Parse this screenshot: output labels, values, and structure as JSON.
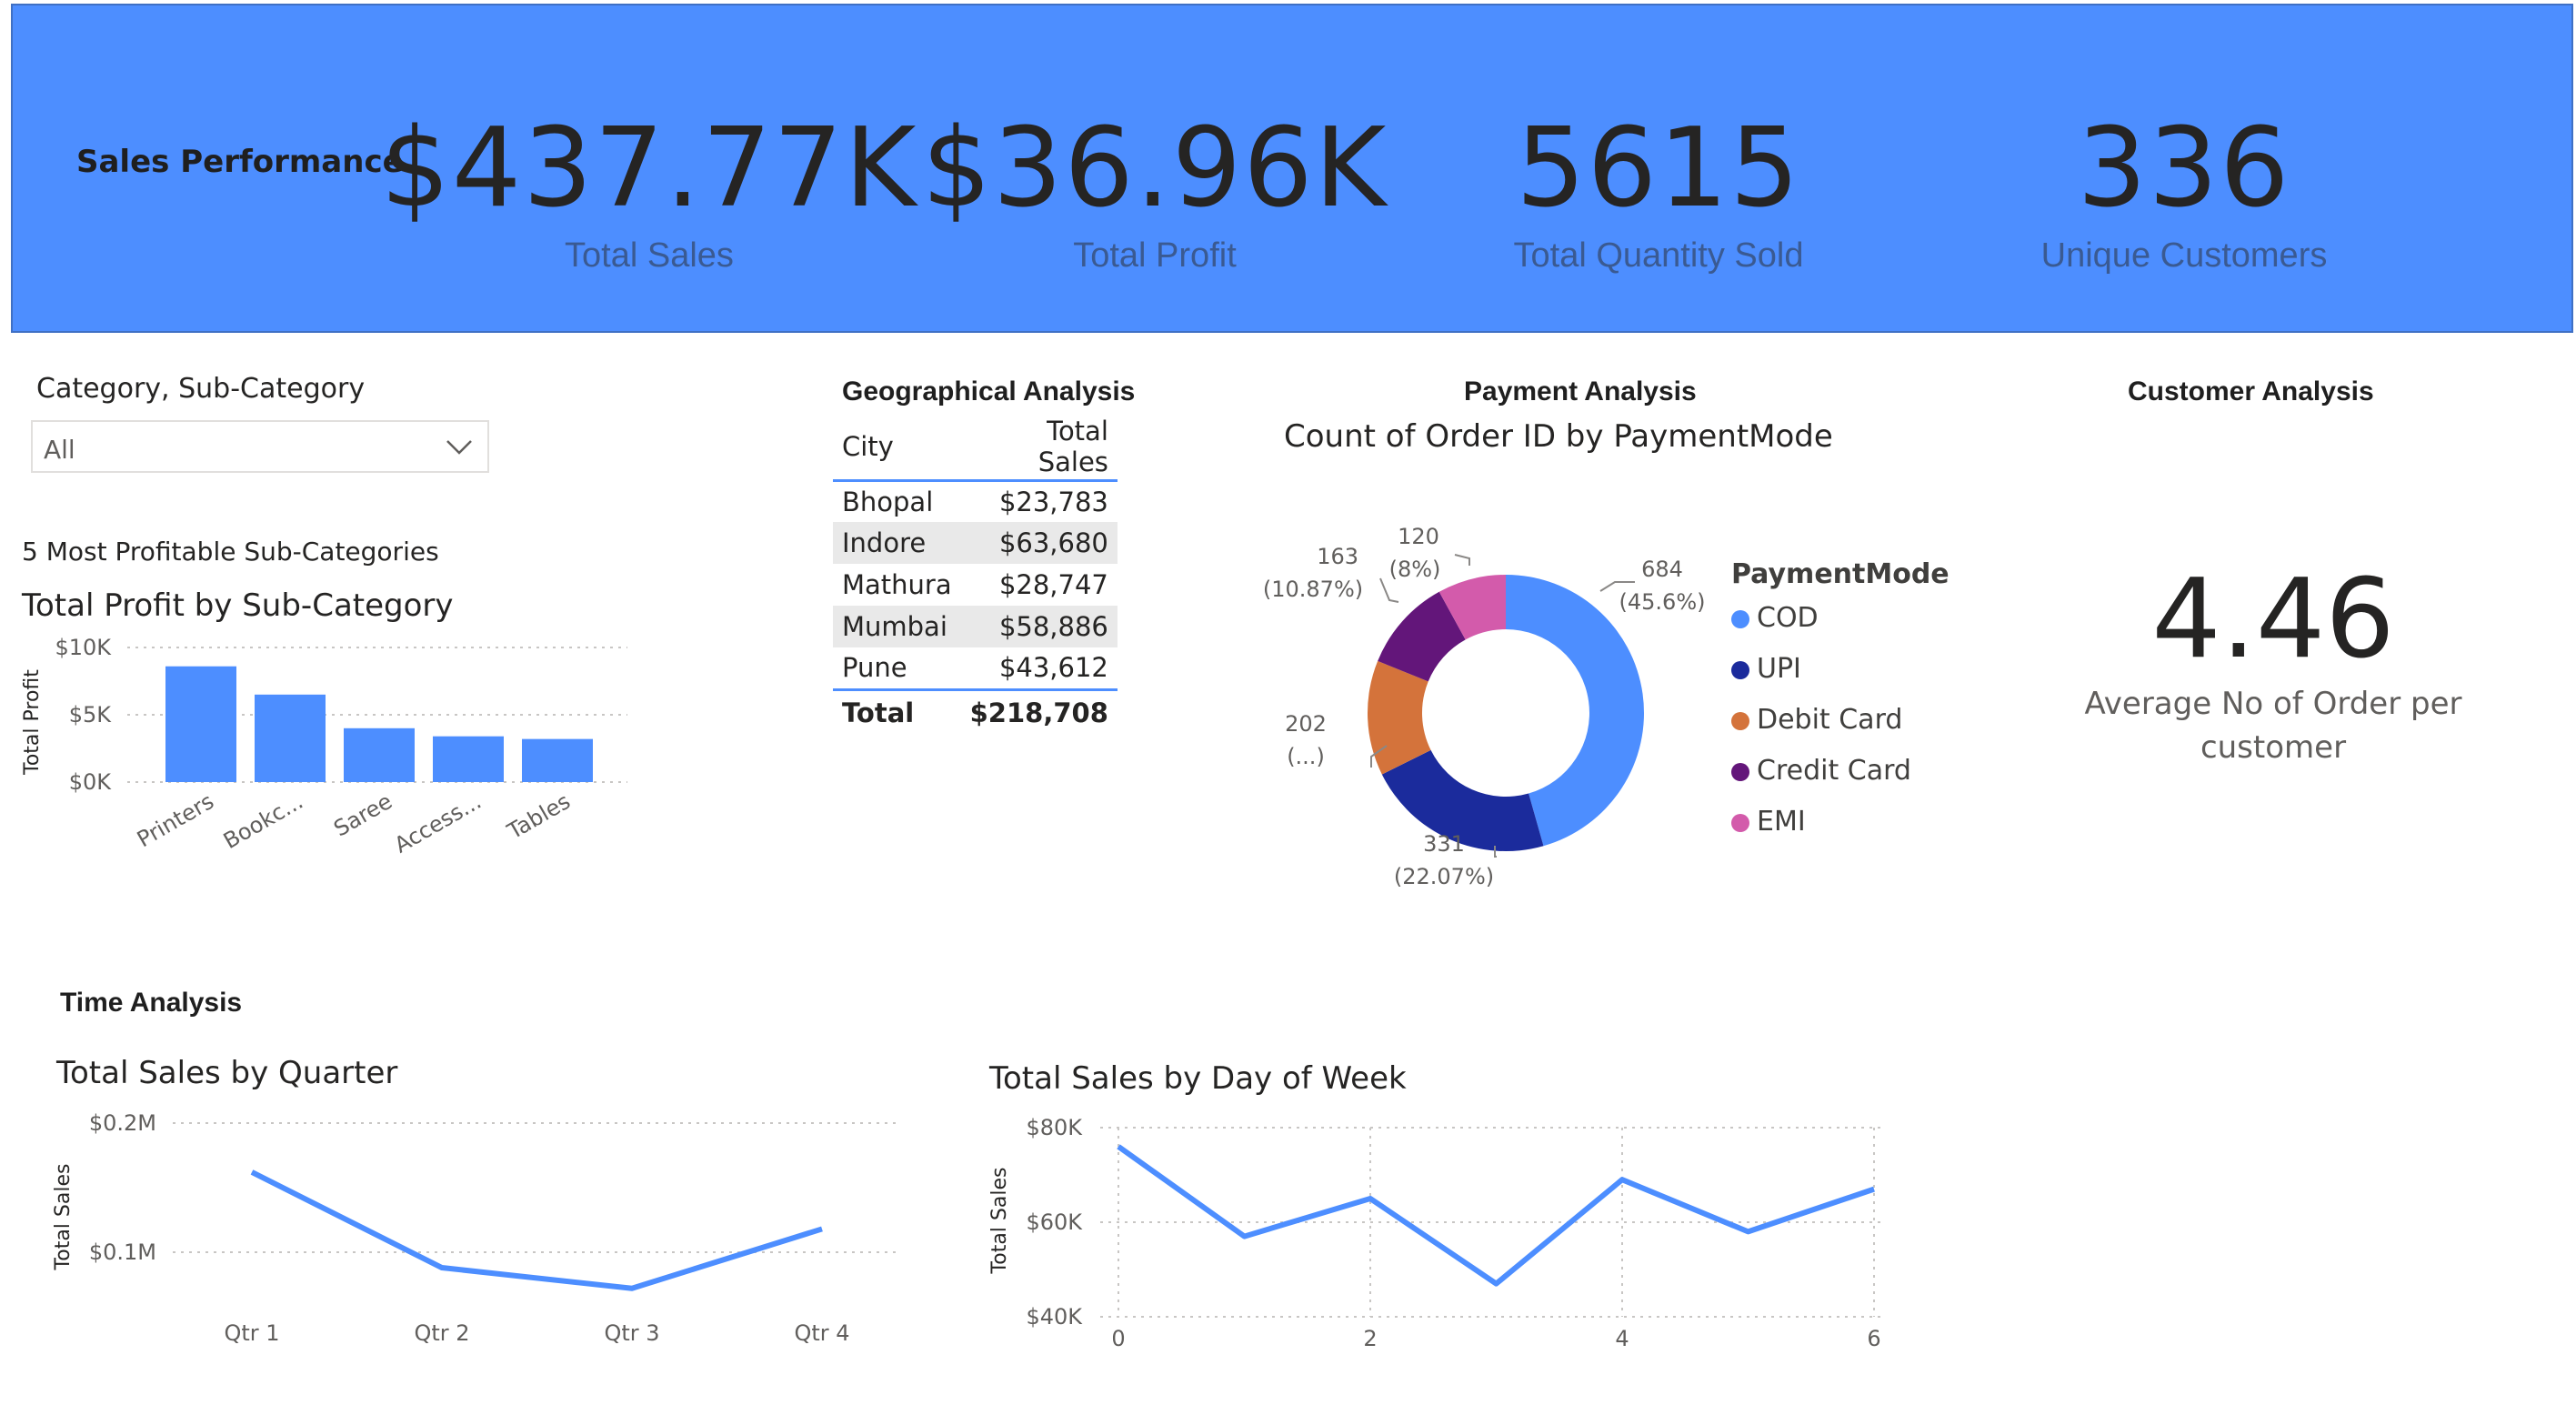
{
  "header": {
    "title": "Sales Performance",
    "kpis": [
      {
        "value": "$437.77K",
        "label": "Total Sales"
      },
      {
        "value": "$36.96K",
        "label": "Total Profit"
      },
      {
        "value": "5615",
        "label": "Total Quantity Sold"
      },
      {
        "value": "336",
        "label": "Unique Customers"
      }
    ]
  },
  "slicer": {
    "label": "Category, Sub-Category",
    "value": "All"
  },
  "subcat": {
    "heading": "5 Most Profitable Sub-Categories",
    "title": "Total Profit by Sub-Category",
    "ylabel": "Total Profit",
    "yticks": [
      "$10K",
      "$5K",
      "$0K"
    ]
  },
  "geo": {
    "title": "Geographical Analysis",
    "columns": [
      "City",
      "Total Sales"
    ],
    "rows": [
      [
        "Bhopal",
        "$23,783"
      ],
      [
        "Indore",
        "$63,680"
      ],
      [
        "Mathura",
        "$28,747"
      ],
      [
        "Mumbai",
        "$58,886"
      ],
      [
        "Pune",
        "$43,612"
      ]
    ],
    "total_label": "Total",
    "total_value": "$218,708"
  },
  "payment": {
    "section_title": "Payment Analysis",
    "title": "Count of Order ID by PaymentMode",
    "legend_title": "PaymentMode",
    "labels": [
      {
        "count": "684",
        "pct": "(45.6%)"
      },
      {
        "count": "331",
        "pct": "(22.07%)"
      },
      {
        "count": "202",
        "pct": "(...)"
      },
      {
        "count": "163",
        "pct": "(10.87%)"
      },
      {
        "count": "120",
        "pct": "(8%)"
      }
    ]
  },
  "customer": {
    "title": "Customer Analysis",
    "value": "4.46",
    "label_line1": "Average No of Order per",
    "label_line2": "customer"
  },
  "time": {
    "section_title": "Time Analysis",
    "quarter": {
      "title": "Total Sales by Quarter",
      "ylabel": "Total Sales",
      "yticks": [
        "$0.2M",
        "$0.1M"
      ]
    },
    "weekday": {
      "title": "Total Sales by Day of Week",
      "ylabel": "Total Sales",
      "yticks": [
        "$80K",
        "$60K",
        "$40K"
      ]
    }
  },
  "colors": {
    "banner": "#4d8eff",
    "bar": "#4d8eff",
    "line": "#4d8eff",
    "cod": "#4d8eff",
    "upi": "#1b2b9c",
    "debit": "#d4733b",
    "credit": "#63167a",
    "emi": "#d35bab"
  },
  "chart_data": [
    {
      "type": "bar",
      "title": "Total Profit by Sub-Category",
      "xlabel": "",
      "ylabel": "Total Profit",
      "categories": [
        "Printers",
        "Bookc...",
        "Saree",
        "Access...",
        "Tables"
      ],
      "values": [
        8600,
        6500,
        4000,
        3400,
        3200
      ],
      "ylim": [
        0,
        10000
      ],
      "grid": true
    },
    {
      "type": "pie",
      "title": "Count of Order ID by PaymentMode",
      "categories": [
        "COD",
        "UPI",
        "Debit Card",
        "Credit Card",
        "EMI"
      ],
      "values": [
        684,
        331,
        202,
        163,
        120
      ],
      "legend": "right"
    },
    {
      "type": "line",
      "title": "Total Sales by Quarter",
      "ylabel": "Total Sales",
      "x": [
        "Qtr 1",
        "Qtr 2",
        "Qtr 3",
        "Qtr 4"
      ],
      "values": [
        162000,
        88000,
        72000,
        118000
      ],
      "ylim": [
        0,
        200000
      ],
      "grid": true
    },
    {
      "type": "line",
      "title": "Total Sales by Day of Week",
      "ylabel": "Total Sales",
      "x": [
        0,
        1,
        2,
        3,
        4,
        5,
        6
      ],
      "values": [
        76000,
        57000,
        65000,
        47000,
        69000,
        58000,
        67000
      ],
      "xticks": [
        "0",
        "2",
        "4",
        "6"
      ],
      "ylim": [
        40000,
        80000
      ],
      "grid": true
    }
  ]
}
